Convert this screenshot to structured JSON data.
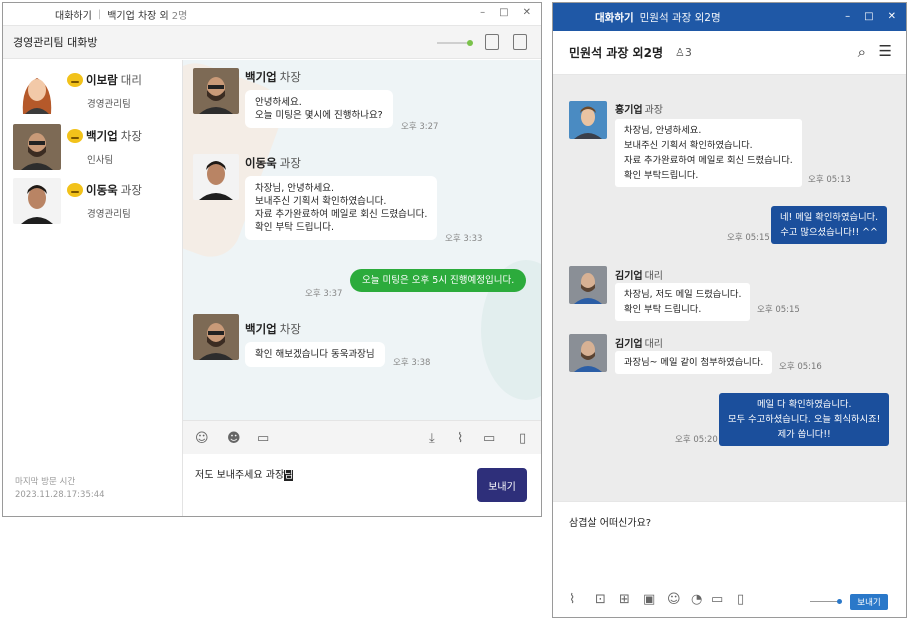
{
  "left_window": {
    "title": "대화하기",
    "subtitle": "백기업 차장 외",
    "count": "2명",
    "room_name": "경영관리팀 대화방",
    "members": [
      {
        "name": "이보람",
        "rank": "대리",
        "team": "경영관리팀"
      },
      {
        "name": "백기업",
        "rank": "차장",
        "team": "인사팀"
      },
      {
        "name": "이동욱",
        "rank": "과장",
        "team": "경영관리팀"
      }
    ],
    "last_visit_label": "마지막 방문 시간",
    "last_visit_value": "2023.11.28.17:35:44",
    "messages": [
      {
        "sender": "백기업",
        "rank": "차장",
        "lines": [
          "안녕하세요.",
          "오늘 미팅은 몇시에 진행하나요?"
        ],
        "time": "오후 3:27"
      },
      {
        "sender": "이동욱",
        "rank": "과장",
        "lines": [
          "차장님, 안녕하세요.",
          "보내주신 기획서 확인하였습니다.",
          "자료 추가완료하여 메일로 회신 드렸습니다.",
          "확인 부탁 드립니다."
        ],
        "time": "오후 3:33"
      },
      {
        "mine": true,
        "lines": [
          "오늘 미팅은 오후 5시 진행예정입니다."
        ],
        "time": "오후 3:37"
      },
      {
        "sender": "백기업",
        "rank": "차장",
        "lines": [
          "확인 해보겠습니다 동욱과장님"
        ],
        "time": "오후 3:38"
      }
    ],
    "input_text": "저도 보내주세요 과장",
    "input_selected": "님",
    "send_label": "보내기"
  },
  "right_window": {
    "brand": "대화하기",
    "subtitle": "민원석 과장 외2명",
    "room_title": "민원석 과장 외2명",
    "participant_count": "3",
    "messages": [
      {
        "sender": "홍기업",
        "rank": "과장",
        "lines": [
          "차장님, 안녕하세요.",
          "보내주신 기획서 확인하였습니다.",
          "자료 추가완료하여 메일로 회신 드렸습니다.",
          "확인 부탁드립니다."
        ],
        "time": "오후 05:13"
      },
      {
        "mine": true,
        "lines": [
          "네! 메일 확인하였습니다.",
          "수고 많으셨습니다!! ^^"
        ],
        "time": "오후 05:15"
      },
      {
        "sender": "김기업",
        "rank": "대리",
        "lines": [
          "차장님, 저도 메일 드렸습니다.",
          "확인 부탁 드립니다."
        ],
        "time": "오후 05:15"
      },
      {
        "sender": "김기업",
        "rank": "대리",
        "lines": [
          "과장님~ 메일 같이 첨부하였습니다."
        ],
        "time": "오후 05:16"
      },
      {
        "mine": true,
        "lines": [
          "메일 다 확인하였습니다.",
          "모두 수고하셨습니다. 오늘 회식하시죠!",
          "제가 쏩니다!!"
        ],
        "time": "오후 05:20"
      }
    ],
    "input_text": "삼겹살 어떠신가요?",
    "send_label": "보내기"
  },
  "colors": {
    "left_send": "#2e2f7a",
    "left_mine_bubble": "#2cab3c",
    "right_titlebar": "#1f58a6",
    "right_mine_bubble": "#1b4f9c"
  }
}
